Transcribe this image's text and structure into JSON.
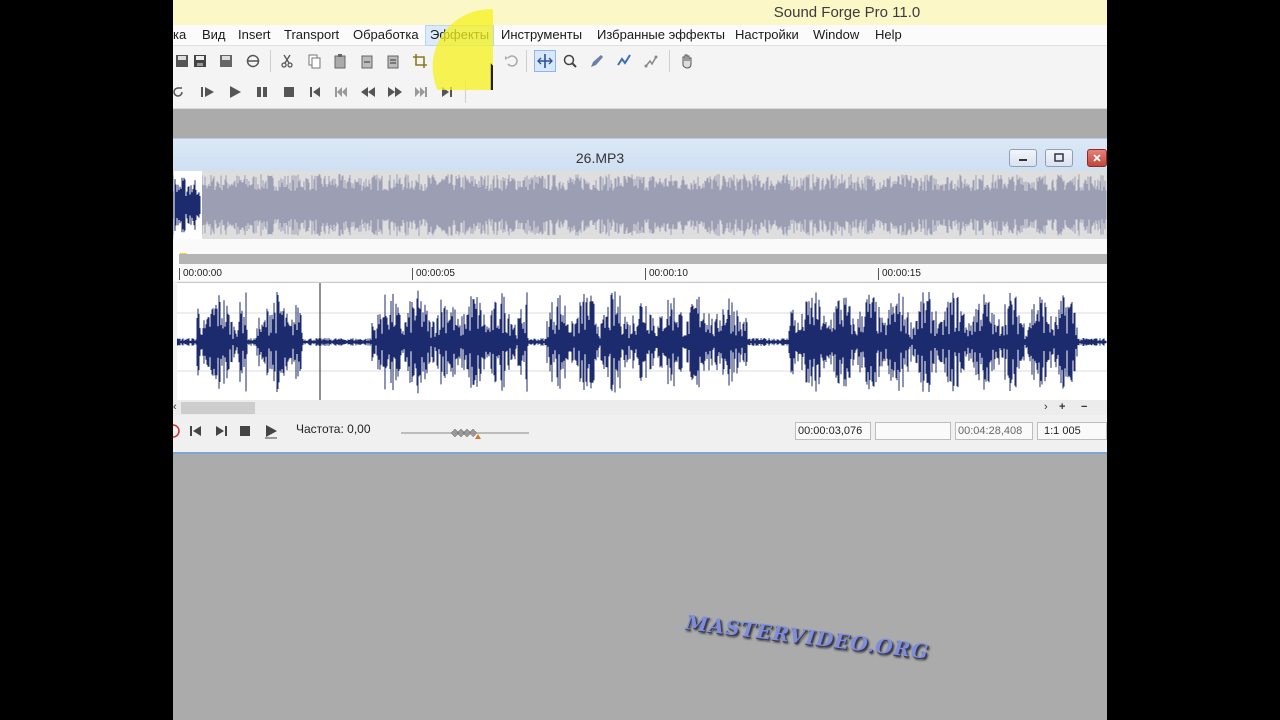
{
  "app": {
    "title": "Sound Forge Pro 11.0"
  },
  "menu": {
    "items": [
      {
        "label": "ка"
      },
      {
        "label": "Вид"
      },
      {
        "label": "Insert"
      },
      {
        "label": "Transport"
      },
      {
        "label": "Обработка"
      },
      {
        "label": "Эффекты"
      },
      {
        "label": "Инструменты"
      },
      {
        "label": "Избранные эффекты"
      },
      {
        "label": "Настройки"
      },
      {
        "label": "Window"
      },
      {
        "label": "Help"
      }
    ],
    "active_index": 5
  },
  "toolbar": {
    "row1_icons": [
      "save-all-icon",
      "save-icon",
      "save-as-icon",
      "render-icon",
      "cut-icon",
      "copy-icon",
      "paste-icon",
      "paste-special-icon",
      "mix-icon",
      "crop-icon",
      "undo-icon",
      "edit-tool-icon",
      "magnify-tool-icon",
      "pencil-tool-icon",
      "envelope-tool-icon",
      "event-tool-icon",
      "hand-icon"
    ],
    "row2_icons": [
      "loop-icon",
      "play-all-icon",
      "play-icon",
      "pause-icon",
      "stop-icon",
      "go-to-start-icon",
      "previous-icon",
      "rewind-icon",
      "fast-forward-icon",
      "next-icon",
      "go-to-end-icon"
    ]
  },
  "document": {
    "title": "26.MP3",
    "ruler_ticks": [
      "00:00:00",
      "00:00:05",
      "00:00:10",
      "00:00:15"
    ],
    "wave_color": "#1c2a6e",
    "overview_color": "#9c9eb4"
  },
  "status": {
    "frequency_label": "Частота: 0,00",
    "cursor_position": "00:00:03,076",
    "selection": "",
    "length": "00:04:28,408",
    "zoom": "1:1 005"
  },
  "watermark": "MASTERVIDEO.ORG"
}
